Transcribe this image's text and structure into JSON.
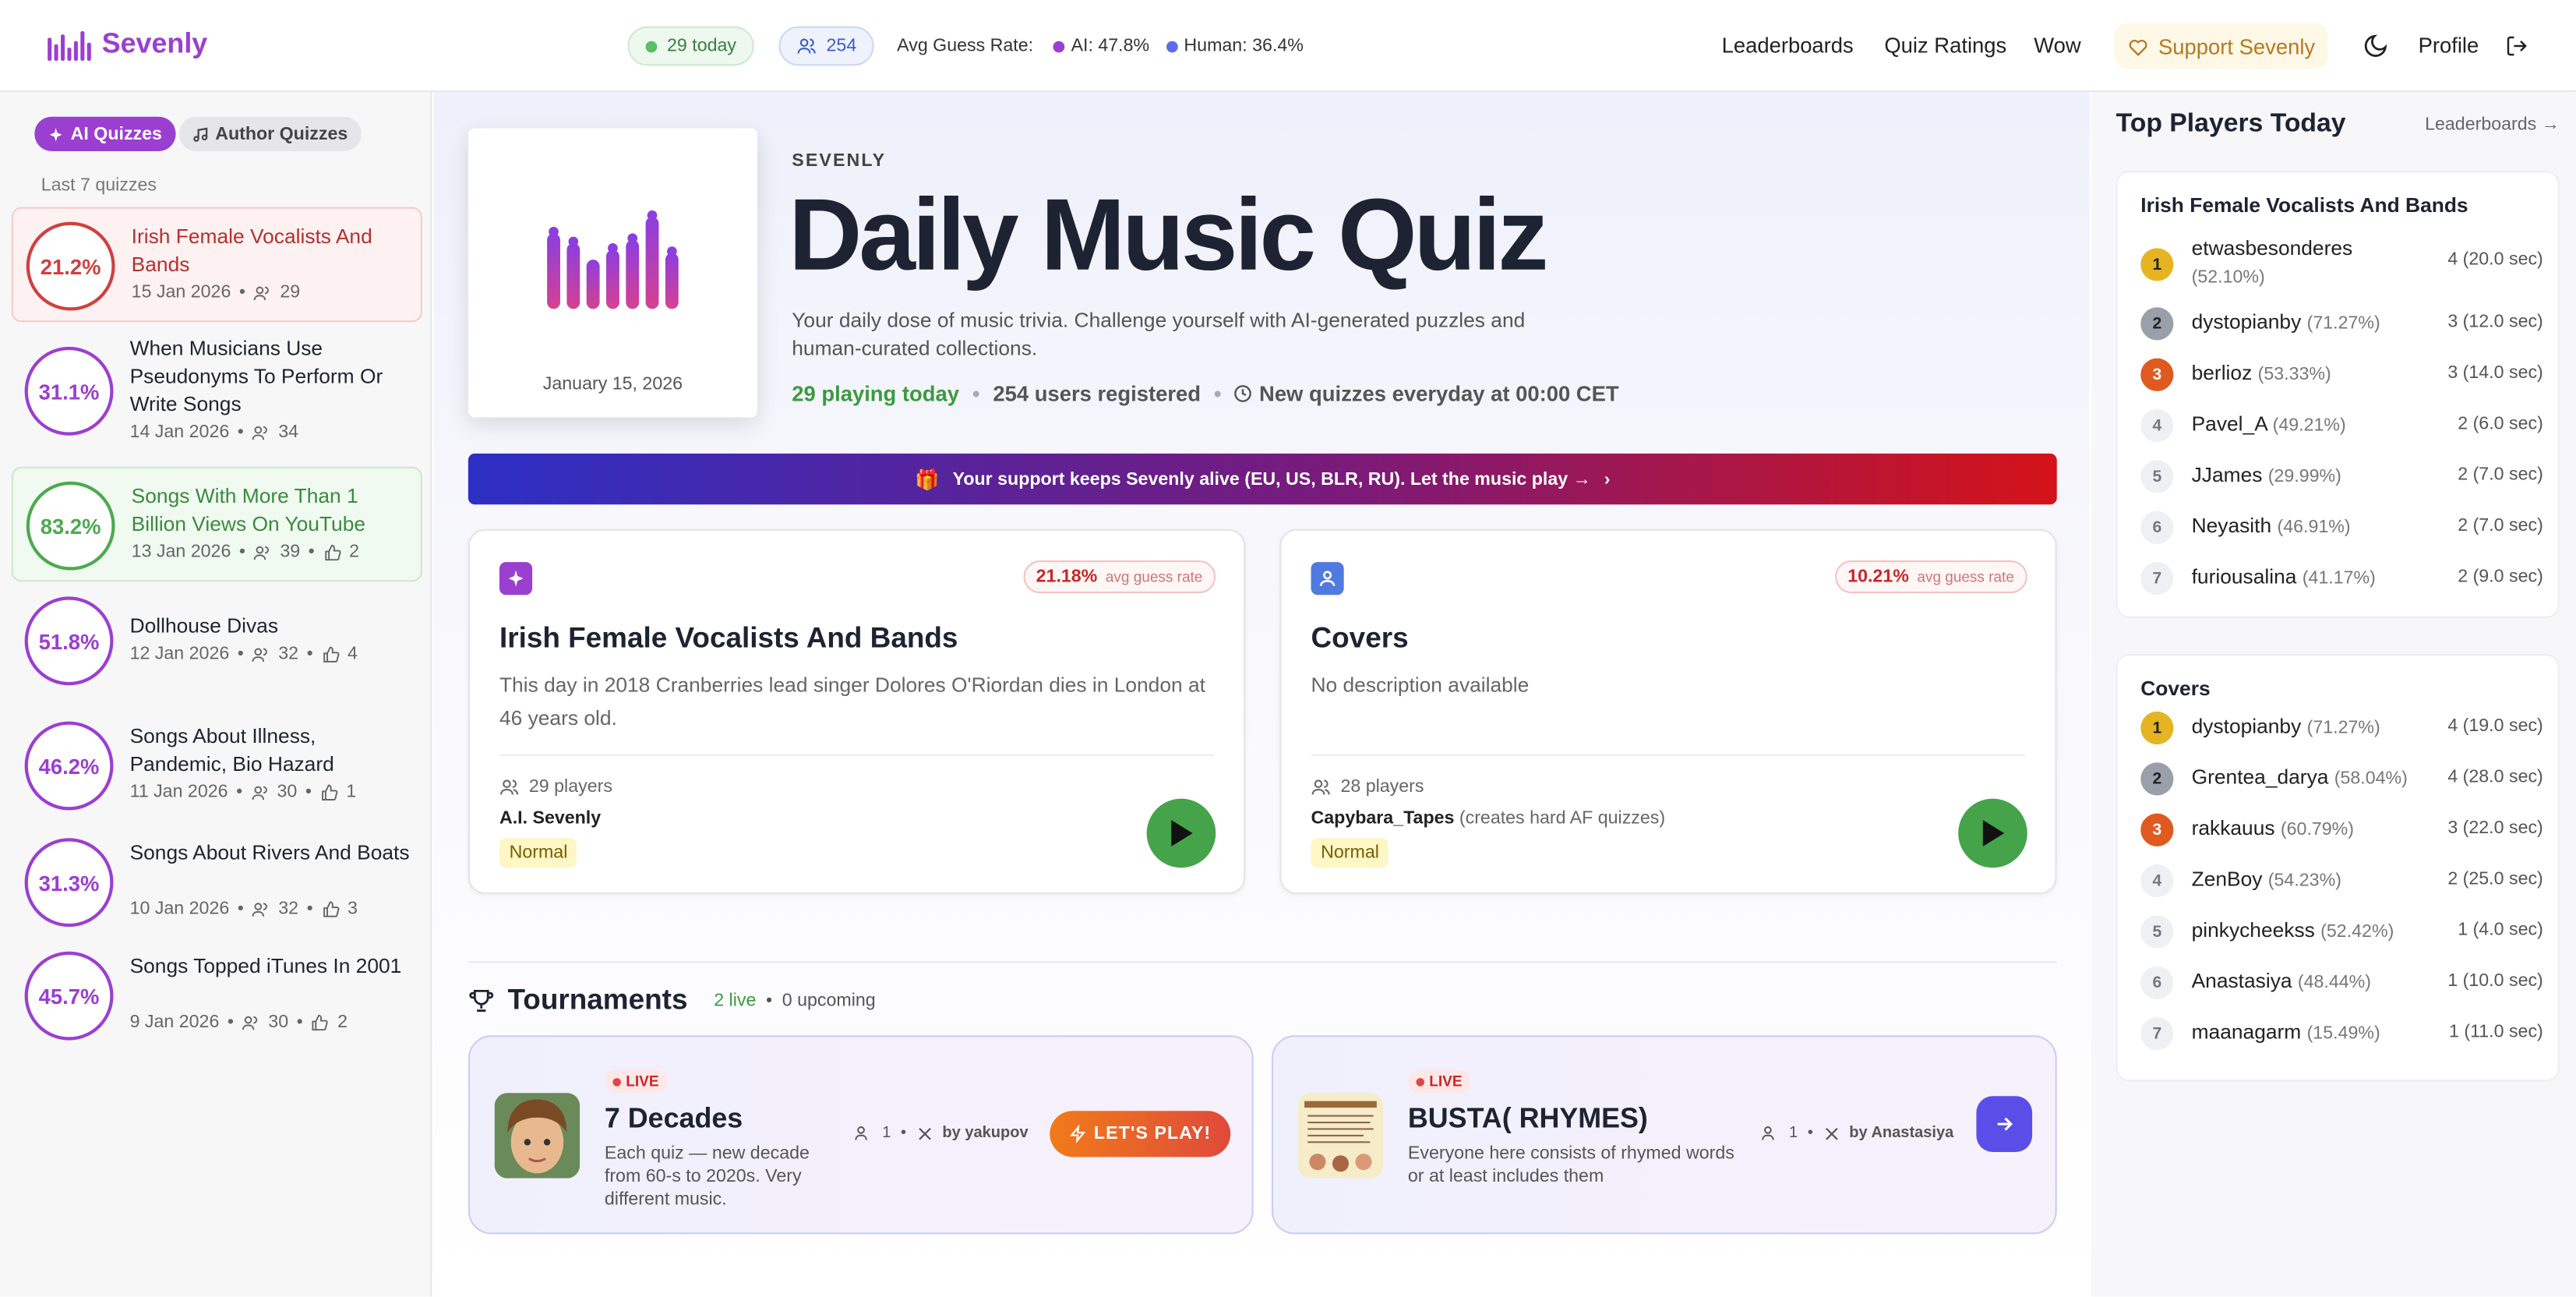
{
  "header": {
    "logo": "Sevenly",
    "today": "29 today",
    "users": "254",
    "avg_label": "Avg Guess Rate:",
    "ai_rate": "AI: 47.8%",
    "human_rate": "Human: 36.4%",
    "nav": [
      "Leaderboards",
      "Quiz Ratings",
      "Wow"
    ],
    "support": "Support Sevenly",
    "profile": "Profile",
    "colors": {
      "brand": "#9b3fd0",
      "ai": "#9b3fd0",
      "human": "#5b6de8"
    }
  },
  "sidebar": {
    "tabs": [
      "AI Quizzes",
      "Author Quizzes"
    ],
    "caption": "Last 7 quizzes",
    "items": [
      {
        "pct": "21.2%",
        "title": "Irish Female Vocalists And Bands",
        "date": "15 Jan 2026",
        "players": "29",
        "likes": ""
      },
      {
        "pct": "31.1%",
        "title": "When Musicians Use Pseudonyms To Perform Or Write Songs",
        "date": "14 Jan 2026",
        "players": "34",
        "likes": ""
      },
      {
        "pct": "83.2%",
        "title": "Songs With More Than 1 Billion Views On YouTube",
        "date": "13 Jan 2026",
        "players": "39",
        "likes": "2"
      },
      {
        "pct": "51.8%",
        "title": "Dollhouse Divas",
        "date": "12 Jan 2026",
        "players": "32",
        "likes": "4"
      },
      {
        "pct": "46.2%",
        "title": "Songs About Illness, Pandemic, Bio Hazard",
        "date": "11 Jan 2026",
        "players": "30",
        "likes": "1"
      },
      {
        "pct": "31.3%",
        "title": "Songs About Rivers And Boats",
        "date": "10 Jan 2026",
        "players": "32",
        "likes": "3"
      },
      {
        "pct": "45.7%",
        "title": "Songs Topped iTunes In 2001",
        "date": "9 Jan 2026",
        "players": "30",
        "likes": "2"
      }
    ]
  },
  "hero": {
    "cover_date": "January 15, 2026",
    "brand": "SEVENLY",
    "title": "Daily Music Quiz",
    "description": "Your daily dose of music trivia. Challenge yourself with AI-generated puzzles and human-curated collections.",
    "playing": "29 playing today",
    "registered": "254 users registered",
    "schedule": "New quizzes everyday at 00:00 CET"
  },
  "banner": "Your support keeps Sevenly alive (EU, US, BLR, RU). Let the music play →",
  "cards": [
    {
      "rate": "21.18%",
      "rate_label": "avg guess rate",
      "title": "Irish Female Vocalists And Bands",
      "desc": "This day in 2018 Cranberries lead singer Dolores O'Riordan dies in London at 46 years old.",
      "players": "29 players",
      "author": "A.I. Sevenly",
      "author_note": "",
      "difficulty": "Normal"
    },
    {
      "rate": "10.21%",
      "rate_label": "avg guess rate",
      "title": "Covers",
      "desc": "No description available",
      "players": "28 players",
      "author": "Capybara_Tapes",
      "author_note": " (creates hard AF quizzes)",
      "difficulty": "Normal"
    }
  ],
  "tournaments": {
    "title": "Tournaments",
    "live": "2 live",
    "upcoming": "0 upcoming",
    "items": [
      {
        "status": "LIVE",
        "name": "7 Decades",
        "desc": "Each quiz — new decade from 60-s to 2020s. Very different music.",
        "count": "1",
        "by": "by yakupov",
        "cta": "LET'S PLAY!"
      },
      {
        "status": "LIVE",
        "name": "BUSTA( RHYMES)",
        "desc": "Everyone here consists of rhymed words or at least includes them",
        "count": "1",
        "by": "by Anastasiya"
      }
    ]
  },
  "right": {
    "title": "Top Players Today",
    "link": "Leaderboards",
    "boards": [
      {
        "title": "Irish Female Vocalists And Bands",
        "rows": [
          {
            "rank": "1",
            "name": "etwasbesonderes",
            "pct": "(52.10%)",
            "score": "4 (20.0 sec)"
          },
          {
            "rank": "2",
            "name": "dystopianby",
            "pct": "(71.27%)",
            "score": "3 (12.0 sec)"
          },
          {
            "rank": "3",
            "name": "berlioz",
            "pct": "(53.33%)",
            "score": "3 (14.0 sec)"
          },
          {
            "rank": "4",
            "name": "Pavel_A",
            "pct": "(49.21%)",
            "score": "2 (6.0 sec)"
          },
          {
            "rank": "5",
            "name": "JJames",
            "pct": "(29.99%)",
            "score": "2 (7.0 sec)"
          },
          {
            "rank": "6",
            "name": "Neyasith",
            "pct": "(46.91%)",
            "score": "2 (7.0 sec)"
          },
          {
            "rank": "7",
            "name": "furiousalina",
            "pct": "(41.17%)",
            "score": "2 (9.0 sec)"
          }
        ]
      },
      {
        "title": "Covers",
        "rows": [
          {
            "rank": "1",
            "name": "dystopianby",
            "pct": "(71.27%)",
            "score": "4 (19.0 sec)"
          },
          {
            "rank": "2",
            "name": "Grentea_darya",
            "pct": "(58.04%)",
            "score": "4 (28.0 sec)"
          },
          {
            "rank": "3",
            "name": "rakkauus",
            "pct": "(60.79%)",
            "score": "3 (22.0 sec)"
          },
          {
            "rank": "4",
            "name": "ZenBoy",
            "pct": "(54.23%)",
            "score": "2 (25.0 sec)"
          },
          {
            "rank": "5",
            "name": "pinkycheekss",
            "pct": "(52.42%)",
            "score": "1 (4.0 sec)"
          },
          {
            "rank": "6",
            "name": "Anastasiya",
            "pct": "(48.44%)",
            "score": "1 (10.0 sec)"
          },
          {
            "rank": "7",
            "name": "maanagarm",
            "pct": "(15.49%)",
            "score": "1 (11.0 sec)"
          }
        ]
      }
    ]
  }
}
